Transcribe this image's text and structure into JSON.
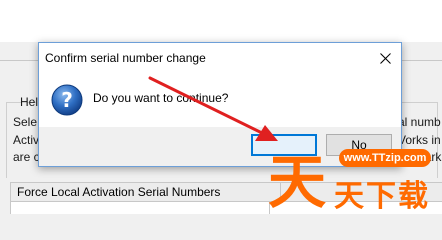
{
  "background": {
    "left_lines": [
      "Hel",
      "Sele",
      "Activ",
      "are c"
    ],
    "right_lines": [
      "al numb",
      "Vorks in",
      "nd mark"
    ],
    "table_header": "Force Local Activation Serial Numbers"
  },
  "dialog": {
    "title": "Confirm serial number change",
    "icon": "question-icon",
    "message": "Do you want to continue?",
    "buttons": {
      "yes": "",
      "no": "No"
    }
  },
  "annotation": {
    "arrow_color": "#e02020"
  },
  "watermark": {
    "url": "www.TTzip.com",
    "brand": "天天下载",
    "color": "#ff6a00"
  }
}
